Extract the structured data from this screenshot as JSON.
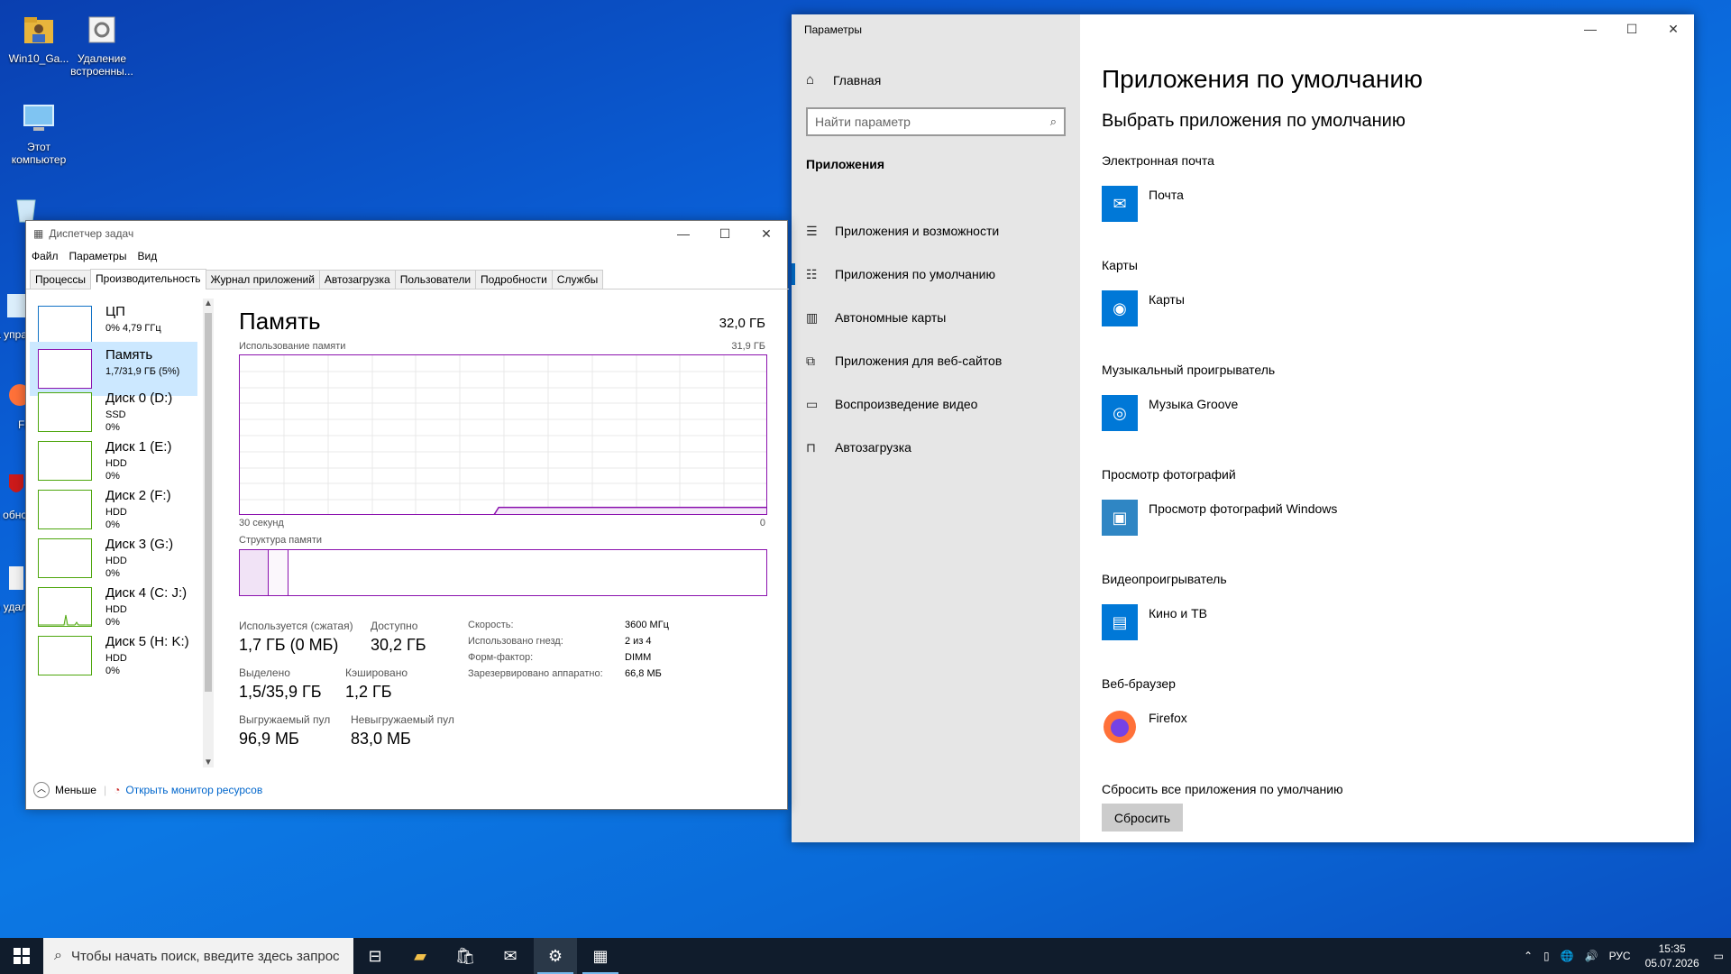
{
  "desktop": {
    "icons": [
      {
        "label": "Win10_Ga...",
        "icon": "folder-user-icon"
      },
      {
        "label": "Удаление встроенны...",
        "icon": "script-file-icon"
      },
      {
        "label": "Этот компьютер",
        "icon": "computer-icon"
      },
      {
        "label": "Ко",
        "icon": "recycle-bin-icon"
      },
      {
        "label": "Па упра",
        "icon": "control-panel-icon"
      },
      {
        "label": "Fi",
        "icon": "firefox-icon"
      },
      {
        "label": "Откл обно",
        "icon": "shield-icon"
      },
      {
        "label": "По удал",
        "icon": "file-icon"
      }
    ]
  },
  "settings": {
    "window_title": "Параметры",
    "home_label": "Главная",
    "search_placeholder": "Найти параметр",
    "section_label": "Приложения",
    "nav": [
      {
        "label": "Приложения и возможности",
        "icon": "list-icon"
      },
      {
        "label": "Приложения по умолчанию",
        "icon": "default-apps-icon",
        "active": true
      },
      {
        "label": "Автономные карты",
        "icon": "map-icon"
      },
      {
        "label": "Приложения для веб-сайтов",
        "icon": "web-apps-icon"
      },
      {
        "label": "Воспроизведение видео",
        "icon": "video-icon"
      },
      {
        "label": "Автозагрузка",
        "icon": "startup-icon"
      }
    ],
    "page_title": "Приложения по умолчанию",
    "page_subtitle": "Выбрать приложения по умолчанию",
    "categories": [
      {
        "label": "Электронная почта",
        "app": "Почта",
        "icon": "mail-icon"
      },
      {
        "label": "Карты",
        "app": "Карты",
        "icon": "maps-icon"
      },
      {
        "label": "Музыкальный проигрыватель",
        "app": "Музыка Groove",
        "icon": "groove-icon"
      },
      {
        "label": "Просмотр фотографий",
        "app": "Просмотр фотографий Windows",
        "icon": "photo-viewer-icon"
      },
      {
        "label": "Видеопроигрыватель",
        "app": "Кино и ТВ",
        "icon": "movies-icon"
      },
      {
        "label": "Веб-браузер",
        "app": "Firefox",
        "icon": "firefox-icon"
      }
    ],
    "reset_label": "Сбросить все приложения по умолчанию",
    "reset_button": "Сбросить"
  },
  "taskmgr": {
    "window_title": "Диспетчер задач",
    "menu": [
      "Файл",
      "Параметры",
      "Вид"
    ],
    "tabs": [
      "Процессы",
      "Производительность",
      "Журнал приложений",
      "Автозагрузка",
      "Пользователи",
      "Подробности",
      "Службы"
    ],
    "active_tab": "Производительность",
    "resources": [
      {
        "name": "ЦП",
        "sub": "0% 4,79 ГГц",
        "color": "#1172c5"
      },
      {
        "name": "Память",
        "sub": "1,7/31,9 ГБ (5%)",
        "color": "#8b12ae",
        "active": true
      },
      {
        "name": "Диск 0 (D:)",
        "sub": "SSD\n0%",
        "color": "#4da60c"
      },
      {
        "name": "Диск 1 (E:)",
        "sub": "HDD\n0%",
        "color": "#4da60c"
      },
      {
        "name": "Диск 2 (F:)",
        "sub": "HDD\n0%",
        "color": "#4da60c"
      },
      {
        "name": "Диск 3 (G:)",
        "sub": "HDD\n0%",
        "color": "#4da60c"
      },
      {
        "name": "Диск 4 (C: J:)",
        "sub": "HDD\n0%",
        "color": "#4da60c"
      },
      {
        "name": "Диск 5 (H: K:)",
        "sub": "HDD\n0%",
        "color": "#4da60c"
      }
    ],
    "memory": {
      "title": "Память",
      "total": "32,0 ГБ",
      "usage_label": "Использование памяти",
      "usage_max": "31,9 ГБ",
      "time_label": "30 секунд",
      "zero_label": "0",
      "usage_fraction": 0.053,
      "composition_label": "Структура памяти",
      "stats": [
        {
          "label": "Используется (сжатая)",
          "value": "1,7 ГБ (0 МБ)"
        },
        {
          "label": "Доступно",
          "value": "30,2 ГБ"
        },
        {
          "label": "Выделено",
          "value": "1,5/35,9 ГБ"
        },
        {
          "label": "Кэшировано",
          "value": "1,2 ГБ"
        },
        {
          "label": "Выгружаемый пул",
          "value": "96,9 МБ"
        },
        {
          "label": "Невыгружаемый пул",
          "value": "83,0 МБ"
        }
      ],
      "specs": [
        {
          "label": "Скорость:",
          "value": "3600 МГц"
        },
        {
          "label": "Использовано гнезд:",
          "value": "2 из 4"
        },
        {
          "label": "Форм-фактор:",
          "value": "DIMM"
        },
        {
          "label": "Зарезервировано аппаратно:",
          "value": "66,8 МБ"
        }
      ]
    },
    "footer": {
      "less": "Меньше",
      "monitor": "Открыть монитор ресурсов"
    }
  },
  "taskbar": {
    "search_placeholder": "Чтобы начать поиск, введите здесь запрос",
    "apps": [
      "task-view-icon",
      "file-explorer-icon",
      "store-icon",
      "mail-icon",
      "settings-gear-icon",
      "task-manager-icon"
    ],
    "language": "РУС",
    "time": "15:35",
    "date": "05.07.2026"
  },
  "colors": {
    "accent": "#0078d7",
    "memory": "#8b12ae",
    "disk": "#4da60c",
    "cpu": "#1172c5"
  }
}
